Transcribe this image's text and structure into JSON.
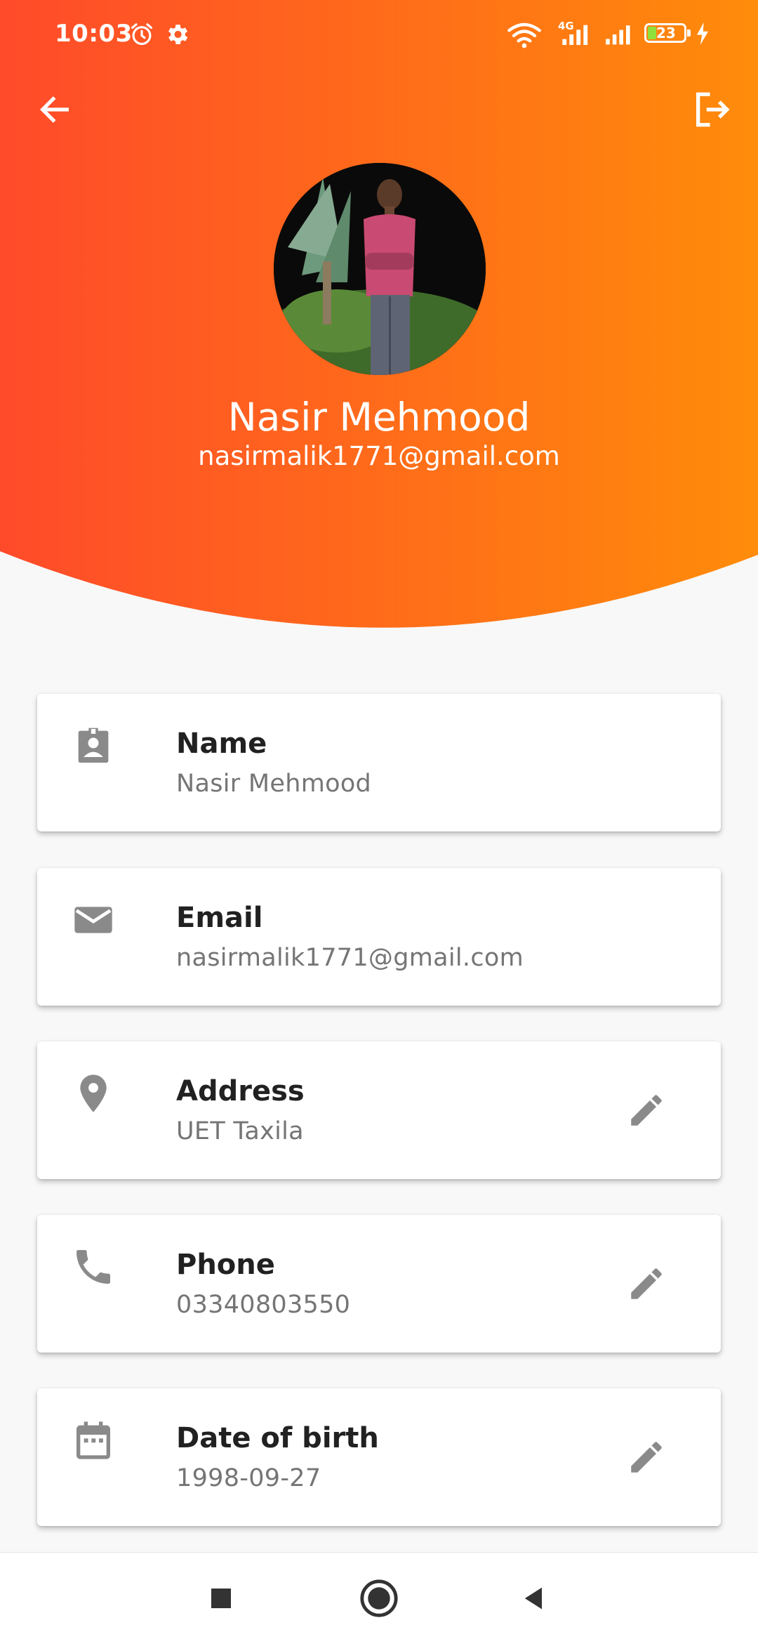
{
  "status_bar": {
    "time": "10:03",
    "network_label": "4G",
    "battery_level": "23"
  },
  "header": {
    "back_icon": "arrow-left-icon",
    "logout_icon": "logout-icon",
    "gradient_start": "#ff4a2a",
    "gradient_end": "#ff8c0a"
  },
  "profile": {
    "name": "Nasir Mehmood",
    "email": "nasirmalik1771@gmail.com"
  },
  "cards": [
    {
      "title": "Name",
      "value": "Nasir Mehmood",
      "icon": "contact-badge-icon",
      "editable": false
    },
    {
      "title": "Email",
      "value": "nasirmalik1771@gmail.com",
      "icon": "mail-icon",
      "editable": false
    },
    {
      "title": "Address",
      "value": "UET Taxila",
      "icon": "location-pin-icon",
      "editable": true
    },
    {
      "title": "Phone",
      "value": "03340803550",
      "icon": "phone-icon",
      "editable": true
    },
    {
      "title": "Date of birth",
      "value": "1998-09-27",
      "icon": "calendar-icon",
      "editable": true
    }
  ],
  "colors": {
    "icon_gray": "#8a8a8a",
    "background": "#f8f8f8"
  }
}
